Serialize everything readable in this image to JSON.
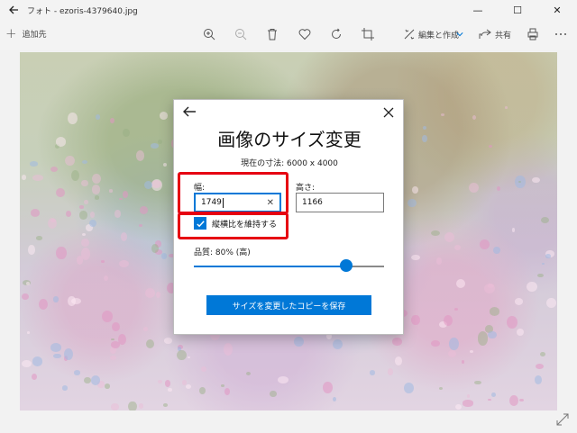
{
  "window": {
    "title": "フォト - ezoris-4379640.jpg",
    "minimize": "—",
    "maximize": "☐",
    "close": "✕"
  },
  "toolbar": {
    "add_label": "追加先",
    "edit_create_label": "編集と作成",
    "share_label": "共有"
  },
  "dialog": {
    "title": "画像のサイズ変更",
    "current_size": "現在の寸法: 6000 x 4000",
    "width_label": "幅:",
    "width_value": "1749",
    "height_label": "高さ:",
    "height_value": "1166",
    "keep_aspect_label": "縦横比を維持する",
    "keep_aspect_checked": true,
    "quality_label": "品質: 80% (高)",
    "quality_fraction": 0.8,
    "save_button_label": "サイズを変更したコピーを保存"
  },
  "colors": {
    "accent": "#0078d7",
    "highlight": "#e60012"
  }
}
